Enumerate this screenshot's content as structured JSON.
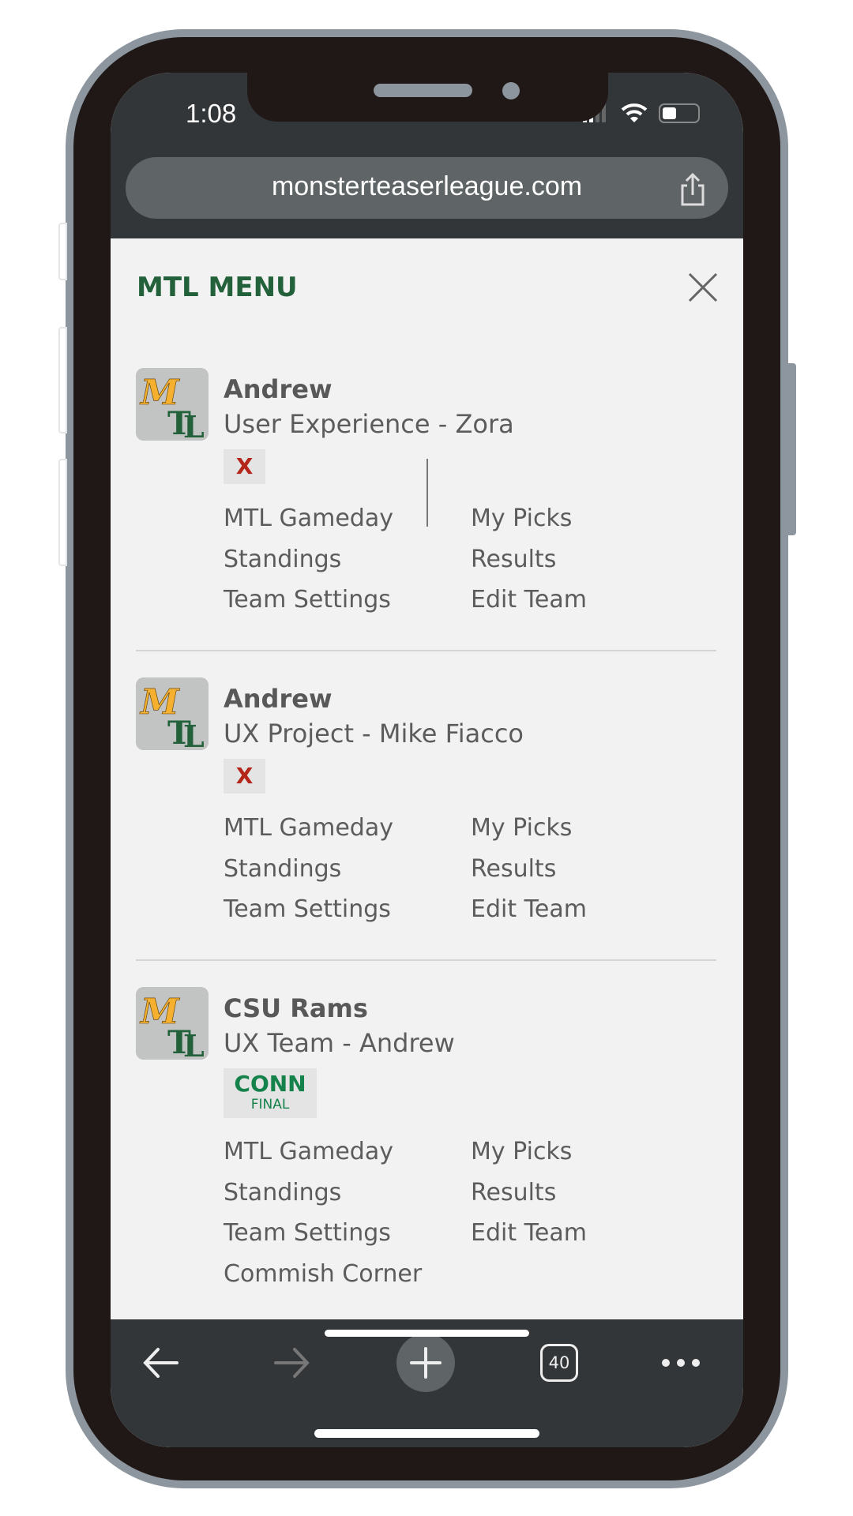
{
  "status_bar": {
    "time": "1:08",
    "battery_level": 0.35
  },
  "browser": {
    "url": "monsterteaserleague.com",
    "tab_count": "40"
  },
  "menu": {
    "title": "MTL MENU",
    "logo_text": "MTL",
    "sections": [
      {
        "name": "Andrew",
        "subtitle": "User Experience - Zora",
        "badge": "X",
        "links": [
          "MTL Gameday",
          "My Picks",
          "Standings",
          "Results",
          "Team Settings",
          "Edit Team"
        ]
      },
      {
        "name": "Andrew",
        "subtitle": "UX Project - Mike Fiacco",
        "badge": "X",
        "links": [
          "MTL Gameday",
          "My Picks",
          "Standings",
          "Results",
          "Team Settings",
          "Edit Team"
        ]
      },
      {
        "name": "CSU Rams",
        "subtitle": "UX Team - Andrew",
        "badge": "CONN",
        "badge_sub": "FINAL",
        "links": [
          "MTL Gameday",
          "My Picks",
          "Standings",
          "Results",
          "Team Settings",
          "Edit Team",
          "Commish Corner"
        ]
      }
    ]
  },
  "colors": {
    "brand_green": "#22613a",
    "logo_gold": "#f4b02e",
    "x_red": "#b4261a",
    "final_green": "#14824a",
    "chrome": "#333639"
  }
}
